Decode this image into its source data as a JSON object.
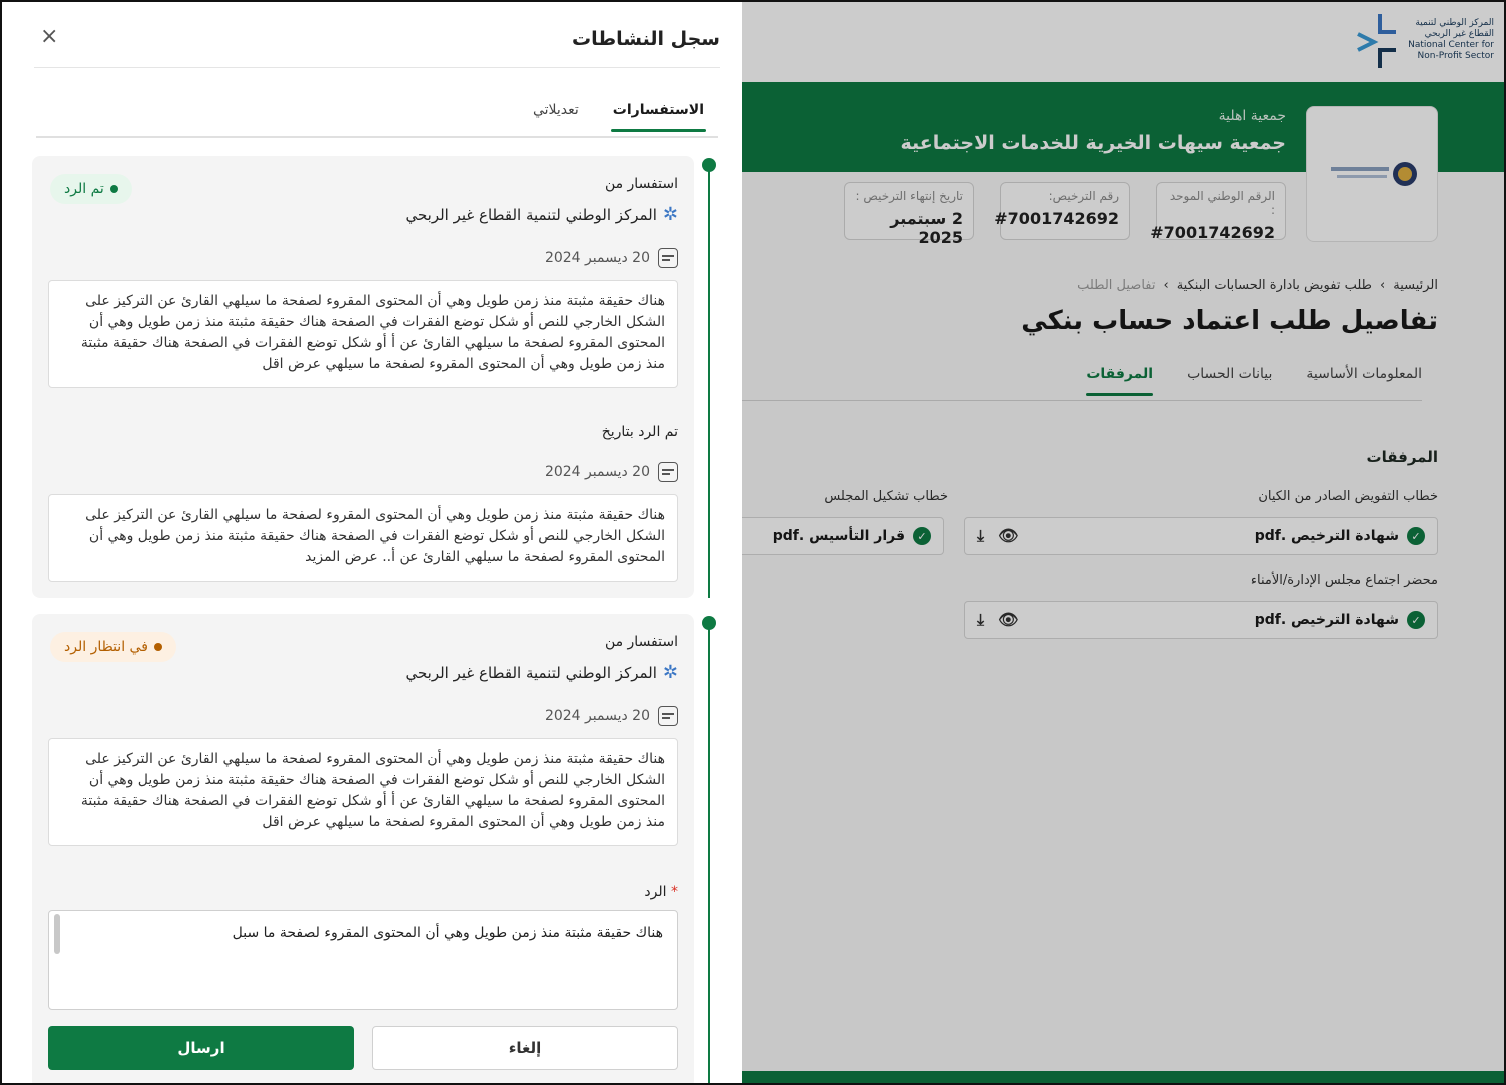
{
  "app": {
    "logo_ar_1": "المركز الوطني لتنمية",
    "logo_ar_2": "القطاع غير الربحي",
    "logo_en_1": "National Center for",
    "logo_en_2": "Non-Profit Sector",
    "org_type": "جمعية اهلية",
    "org_name": "جمعية سيهات الخيرية للخدمات الاجتماعية",
    "info": [
      {
        "label": "الرقم الوطني الموحد :",
        "value": "#7001742692"
      },
      {
        "label": "رقم الترخيص:",
        "value": "#7001742692"
      },
      {
        "label": "تاريخ إنتهاء الترخيص :",
        "value": "2 سبتمبر 2025"
      }
    ],
    "breadcrumb": {
      "home": "الرئيسية",
      "sep": "›",
      "parent": "طلب تفويض بادارة الحسابات البنكية",
      "current": "تفاصيل الطلب"
    },
    "page_title": "تفاصيل طلب اعتماد حساب بنكي",
    "tabs": [
      "المعلومات الأساسية",
      "بيانات الحساب",
      "المرفقات"
    ],
    "section_title": "المرفقات",
    "fields": {
      "delegation_letter": "خطاب التفويض الصادر من الكيان",
      "council_letter": "خطاب تشكيل المجلس",
      "meeting_minutes": "محضر اجتماع مجلس الإدارة/الأمناء"
    },
    "files": {
      "license": "شهادة الترخيص .pdf",
      "founding": "قرار التأسيس .pdf"
    }
  },
  "panel": {
    "title": "سجل النشاطات",
    "close": "×",
    "tabs": {
      "inquiries": "الاستفسارات",
      "edits": "تعديلاتي"
    },
    "card1": {
      "label": "استفسار من",
      "org": "المركز الوطني لتنمية القطاع غير الربحي",
      "date": "20 ديسمبر 2024",
      "status": "تم الرد",
      "text": "هناك حقيقة مثبتة منذ زمن طويل وهي أن المحتوى المقروء لصفحة ما سيلهي القارئ عن التركيز على الشكل الخارجي للنص أو شكل توضع الفقرات في الصفحة هناك حقيقة مثبتة منذ زمن طويل وهي أن المحتوى المقروء لصفحة ما سيلهي القارئ عن أ أو شكل توضع الفقرات في الصفحة هناك حقيقة مثبتة منذ زمن طويل وهي أن المحتوى المقروء لصفحة ما سيلهي  عرض اقل",
      "reply_label": "تم الرد بتاريخ",
      "reply_date": "20 ديسمبر 2024",
      "reply_text": "هناك حقيقة مثبتة منذ زمن طويل وهي أن المحتوى المقروء لصفحة ما سيلهي القارئ عن التركيز على الشكل الخارجي للنص أو شكل توضع الفقرات في الصفحة هناك حقيقة مثبتة منذ زمن طويل وهي أن المحتوى المقروء لصفحة ما سيلهي القارئ عن أ.. عرض المزيد"
    },
    "card2": {
      "label": "استفسار من",
      "org": "المركز الوطني لتنمية القطاع غير الربحي",
      "date": "20 ديسمبر 2024",
      "status": "في انتظار الرد",
      "text": "هناك حقيقة مثبتة منذ زمن طويل وهي أن المحتوى المقروء لصفحة ما سيلهي القارئ عن التركيز على الشكل الخارجي للنص أو شكل توضع الفقرات في الصفحة هناك حقيقة مثبتة منذ زمن طويل وهي أن المحتوى المقروء لصفحة ما سيلهي القارئ عن أ أو شكل توضع الفقرات في الصفحة هناك حقيقة مثبتة منذ زمن طويل وهي أن المحتوى المقروء لصفحة ما سيلهي  عرض اقل",
      "reply_field_label": "الرد",
      "reply_required": "*",
      "reply_value": "هناك حقيقة مثبتة منذ زمن طويل وهي أن المحتوى المقروء لصفحة ما سبل",
      "cancel": "إلغاء",
      "send": "ارسال"
    }
  },
  "colors": {
    "primary": "#0e7a43",
    "pending": "#b35f00"
  }
}
